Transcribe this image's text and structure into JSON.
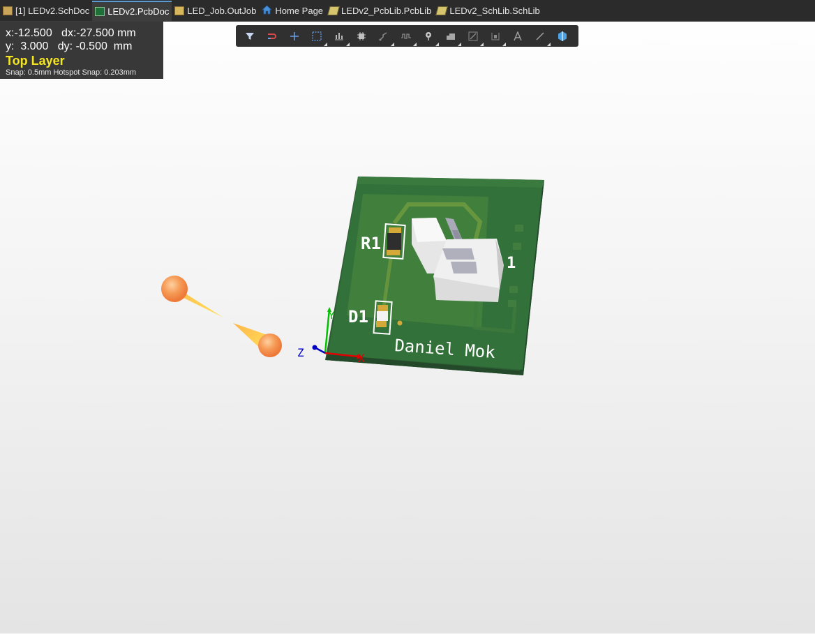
{
  "tabs": [
    {
      "label": "[1] LEDv2.SchDoc",
      "icon": "schematic-doc-icon",
      "active": false
    },
    {
      "label": "LEDv2.PcbDoc",
      "icon": "pcb-doc-icon",
      "active": true
    },
    {
      "label": "LED_Job.OutJob",
      "icon": "outjob-doc-icon",
      "active": false
    },
    {
      "label": "Home Page",
      "icon": "home-icon",
      "active": false
    },
    {
      "label": "LEDv2_PcbLib.PcbLib",
      "icon": "pcb-library-icon",
      "active": false
    },
    {
      "label": "LEDv2_SchLib.SchLib",
      "icon": "schematic-library-icon",
      "active": false
    }
  ],
  "hud": {
    "line1": "x:-12.500   dx:-27.500 mm",
    "line2": "y:  3.000   dy: -0.500  mm",
    "layer": "Top Layer",
    "snap": "Snap: 0.5mm Hotspot Snap: 0.203mm"
  },
  "toolbar": [
    "filter-icon",
    "interactive-routing-icon",
    "cross-icon",
    "select-rect-icon",
    "align-icon",
    "component-icon",
    "route-icon",
    "tune-length-icon",
    "via-pin-icon",
    "polygon-icon",
    "dimension-icon",
    "region-icon",
    "text-icon",
    "line-icon",
    "shape-3d-icon"
  ],
  "board": {
    "designators": {
      "r1": "R1",
      "d1": "D1",
      "j1": "J1"
    },
    "silk_text": "Daniel Mok",
    "axes": {
      "x": "X",
      "y": "Y",
      "z": "Z"
    }
  },
  "colors": {
    "board": "#2f6b36",
    "board_light": "#4d8a3d",
    "silk": "#ffffff",
    "layer_label": "#f5e623",
    "tab_active": "#3d3d3d"
  }
}
